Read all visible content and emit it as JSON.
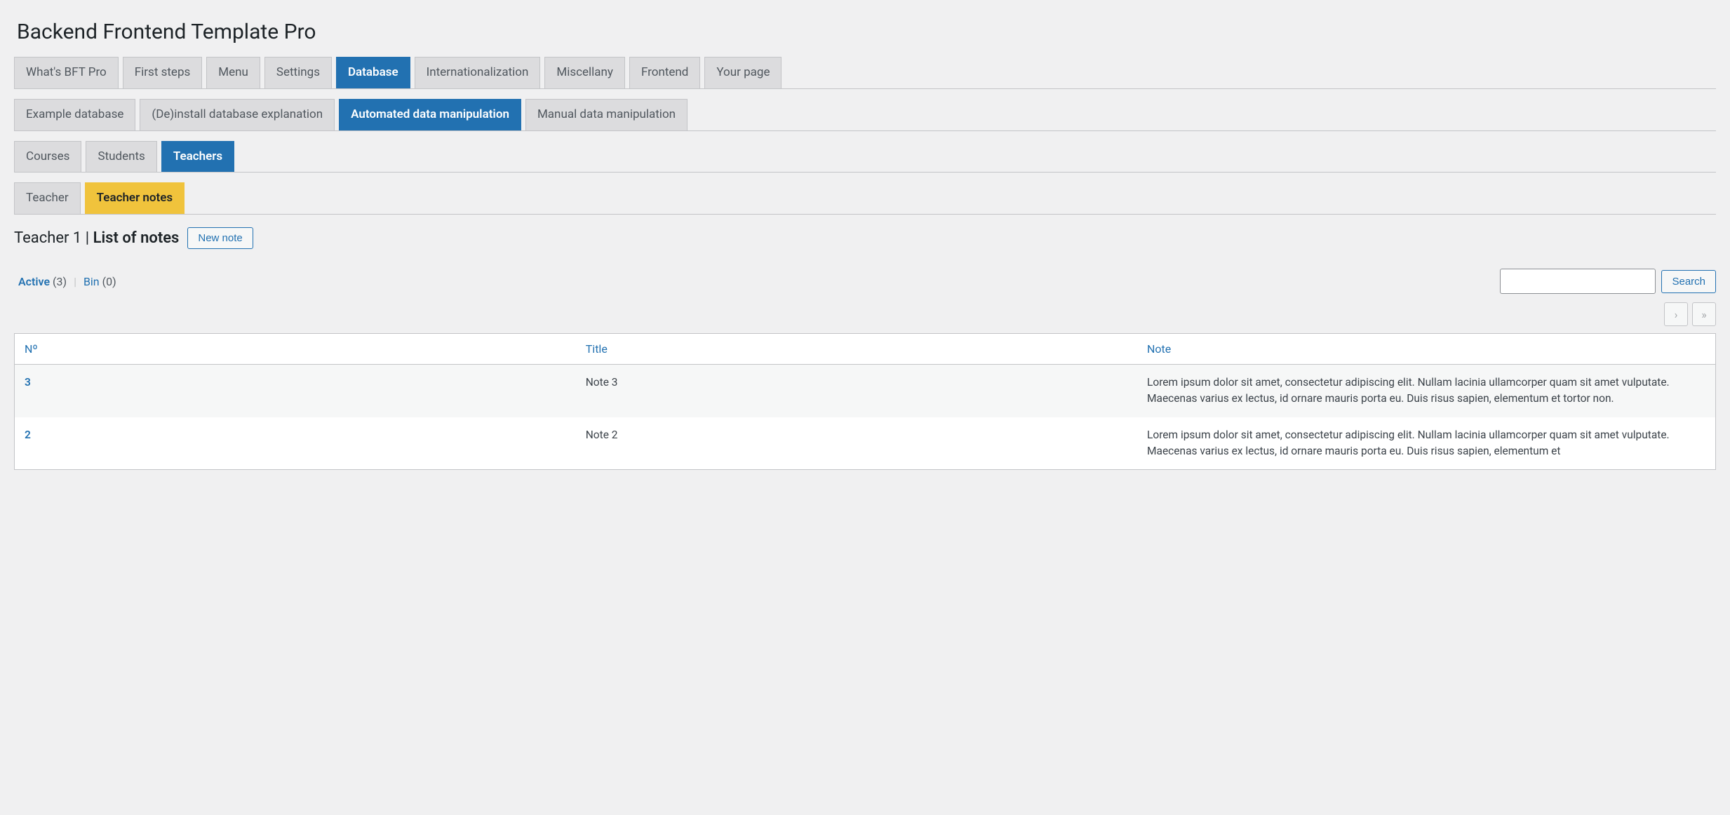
{
  "page_title": "Backend Frontend Template Pro",
  "tabs_main": [
    {
      "label": "What's BFT Pro",
      "active": false
    },
    {
      "label": "First steps",
      "active": false
    },
    {
      "label": "Menu",
      "active": false
    },
    {
      "label": "Settings",
      "active": false
    },
    {
      "label": "Database",
      "active": true
    },
    {
      "label": "Internationalization",
      "active": false
    },
    {
      "label": "Miscellany",
      "active": false
    },
    {
      "label": "Frontend",
      "active": false
    },
    {
      "label": "Your page",
      "active": false
    }
  ],
  "tabs_sub1": [
    {
      "label": "Example database",
      "active": false
    },
    {
      "label": "(De)install database explanation",
      "active": false
    },
    {
      "label": "Automated data manipulation",
      "active": true
    },
    {
      "label": "Manual data manipulation",
      "active": false
    }
  ],
  "tabs_sub2": [
    {
      "label": "Courses",
      "active": false
    },
    {
      "label": "Students",
      "active": false
    },
    {
      "label": "Teachers",
      "active": true
    }
  ],
  "tabs_sub3": [
    {
      "label": "Teacher",
      "style": "default"
    },
    {
      "label": "Teacher notes",
      "style": "yellow"
    }
  ],
  "content_header": {
    "prefix": "Teacher 1 | ",
    "strong": "List of notes",
    "new_button": "New note"
  },
  "filters": {
    "active_label": "Active",
    "active_count": "(3)",
    "bin_label": "Bin",
    "bin_count": "(0)"
  },
  "search": {
    "button": "Search",
    "placeholder": ""
  },
  "pager": {
    "next": "›",
    "last": "»"
  },
  "table": {
    "headers": {
      "num": "Nº",
      "title": "Title",
      "note": "Note"
    },
    "rows": [
      {
        "id": "3",
        "title": "Note 3",
        "note": "Lorem ipsum dolor sit amet, consectetur adipiscing elit. Nullam lacinia ullamcorper quam sit amet vulputate. Maecenas varius ex lectus, id ornare mauris porta eu. Duis risus sapien, elementum et tortor non."
      },
      {
        "id": "2",
        "title": "Note 2",
        "note": "Lorem ipsum dolor sit amet, consectetur adipiscing elit. Nullam lacinia ullamcorper quam sit amet vulputate. Maecenas varius ex lectus, id ornare mauris porta eu. Duis risus sapien, elementum et"
      }
    ]
  }
}
